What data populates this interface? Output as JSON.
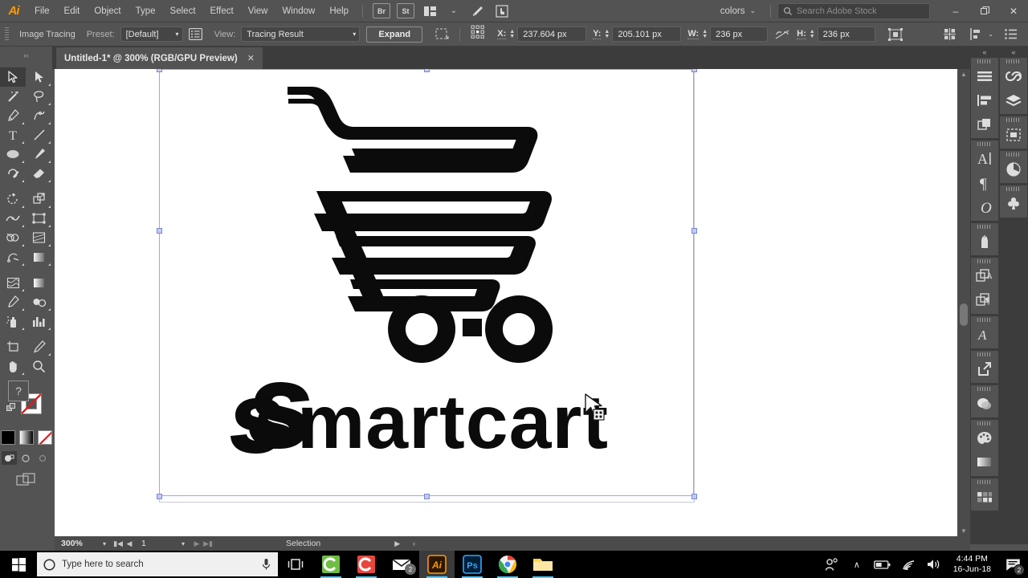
{
  "app": {
    "name": "Adobe Illustrator",
    "logo_text": "Ai",
    "accent_color": "#ff9a00",
    "chrome_color": "#535353",
    "selection_color": "#9aa7e8"
  },
  "menubar": {
    "items": [
      "File",
      "Edit",
      "Object",
      "Type",
      "Select",
      "Effect",
      "View",
      "Window",
      "Help"
    ],
    "bridge_label": "Br",
    "stock_label": "St",
    "arrange_icon": "arrange-documents-icon",
    "workspace_caret": "⌄",
    "brush_icon": "brush-icon",
    "touch_icon": "touch-workspace-icon",
    "workspace_name": "colors",
    "workspace_caret2": "⌄",
    "search_placeholder": "Search Adobe Stock",
    "search_value": "",
    "win_minimize": "–",
    "win_restore": "❐",
    "win_close": "✕"
  },
  "controlbar": {
    "title": "Image Tracing",
    "preset_label": "Preset:",
    "preset_value": "[Default]",
    "tracing_panel_icon": "image-tracing-panel-icon",
    "view_label": "View:",
    "view_value": "Tracing Result",
    "expand_label": "Expand",
    "transform_icon": "transform-selection-icon",
    "reference_point": "reference-point-grid",
    "x_label": "X:",
    "x_value": "237.604 px",
    "y_label": "Y:",
    "y_value": "205.101 px",
    "w_label": "W:",
    "w_value": "236 px",
    "lock_ratio_icon": "unlink-proportions-icon",
    "h_label": "H:",
    "h_value": "236 px",
    "shape_icon": "bounding-box-icon",
    "align_icon": "align-icon",
    "distribute_icon": "distribute-icon",
    "distribute_caret": "⌄",
    "options_icon": "more-options-icon"
  },
  "document": {
    "tab_title": "Untitled-1* @ 300% (RGB/GPU Preview)",
    "tab_close": "✕"
  },
  "toolbar": {
    "grip": "‹‹",
    "tools": [
      {
        "name": "selection-tool",
        "active": true
      },
      {
        "name": "direct-selection-tool",
        "active": false
      },
      {
        "name": "magic-wand-tool",
        "active": false
      },
      {
        "name": "lasso-tool",
        "active": false
      },
      {
        "name": "pen-tool",
        "active": false
      },
      {
        "name": "curvature-tool",
        "active": false
      },
      {
        "name": "type-tool",
        "active": false
      },
      {
        "name": "line-segment-tool",
        "active": false
      },
      {
        "name": "ellipse-tool",
        "active": false
      },
      {
        "name": "paintbrush-tool",
        "active": false
      },
      {
        "name": "shaper-tool",
        "active": false
      },
      {
        "name": "eraser-tool",
        "active": false
      },
      {
        "name": "rotate-tool",
        "active": false
      },
      {
        "name": "scale-tool",
        "active": false
      },
      {
        "name": "width-tool",
        "active": false
      },
      {
        "name": "free-transform-tool",
        "active": false
      },
      {
        "name": "shape-builder-tool",
        "active": false
      },
      {
        "name": "perspective-grid-tool",
        "active": false
      },
      {
        "name": "mesh-tool",
        "active": false
      },
      {
        "name": "gradient-tool",
        "active": false
      },
      {
        "name": "eyedropper-tool",
        "active": false
      },
      {
        "name": "blend-tool",
        "active": false
      },
      {
        "name": "symbol-sprayer-tool",
        "active": false
      },
      {
        "name": "column-graph-tool",
        "active": false
      },
      {
        "name": "artboard-tool",
        "active": false
      },
      {
        "name": "slice-tool",
        "active": false
      },
      {
        "name": "hand-tool",
        "active": false
      },
      {
        "name": "zoom-tool",
        "active": false
      }
    ],
    "fill_label": "?",
    "fill_color": "#535353",
    "stroke_color": "#ffffff",
    "swatch_black": "#000000",
    "swatch_gradient": "linear-gradient",
    "swatch_none": "none",
    "draw_modes": [
      "draw-normal",
      "draw-behind",
      "draw-inside"
    ],
    "screen_mode": "change-screen-mode"
  },
  "canvas": {
    "background": "#ffffff",
    "artwork_name": "smartcart-logo",
    "wordmark": "smartcart",
    "cart_icon": "shopping-cart-artwork",
    "cursor": "selection-arrow-cursor"
  },
  "statusbar": {
    "zoom_value": "300%",
    "zoom_caret": "⌄",
    "nav_first": "⏮",
    "nav_prev": "◀",
    "page_value": "1",
    "page_caret": "⌄",
    "nav_next": "▶",
    "nav_last": "⏭",
    "tool_status": "Selection",
    "arrow_right": "▶",
    "arrow_left": "‹"
  },
  "dock": {
    "collapse_left": "«",
    "collapse_right": "«",
    "groups_left": [
      [
        "align-panel-icon",
        "align-objects-icon",
        "pathfinder-panel-icon"
      ],
      [
        "character-panel-icon",
        "paragraph-panel-icon",
        "glyphs-panel-icon"
      ],
      [
        "brushes-panel-icon"
      ],
      [
        "appearance-panel-icon",
        "graphic-styles-panel-icon"
      ],
      [
        "type-styles-panel-icon"
      ],
      [
        "export-panel-icon"
      ],
      [
        "transparency-panel-icon"
      ],
      [
        "color-panel-icon",
        "color-guide-panel-icon"
      ],
      [
        "swatches-panel-icon"
      ]
    ],
    "groups_right": [
      [
        "libraries-panel-icon",
        "layers-panel-icon"
      ],
      [
        "artboards-panel-icon"
      ],
      [
        "image-trace-panel-icon"
      ],
      [
        "symbols-panel-icon"
      ]
    ]
  },
  "taskbar": {
    "start_icon": "windows-start-icon",
    "search_placeholder": "Type here to search",
    "cortana_icon": "microphone-icon",
    "task_view_icon": "task-view-icon",
    "apps": [
      {
        "name": "camtasia-app-icon",
        "label": "C",
        "color": "#6fbe44",
        "active": false,
        "running": true
      },
      {
        "name": "camtasia-recorder-app-icon",
        "label": "C",
        "color": "#e8453c",
        "active": false,
        "running": true
      },
      {
        "name": "mail-app-icon",
        "label": "✉",
        "color": "#ffffff",
        "active": false,
        "running": false,
        "badge": "2"
      },
      {
        "name": "illustrator-app-icon",
        "label": "Ai",
        "color": "#ff9a00",
        "active": true,
        "running": true
      },
      {
        "name": "photoshop-app-icon",
        "label": "Ps",
        "color": "#31a8ff",
        "active": false,
        "running": true
      },
      {
        "name": "chrome-app-icon",
        "label": "",
        "color": "#4285f4",
        "active": false,
        "running": true
      },
      {
        "name": "file-explorer-app-icon",
        "label": "",
        "color": "#ffd04b",
        "active": false,
        "running": true
      }
    ],
    "tray": {
      "people_icon": "people-icon",
      "show_hidden_icon": "∧",
      "battery_icon": "battery-icon",
      "network_icon": "wifi-icon",
      "volume_icon": "volume-icon",
      "time": "4:44 PM",
      "date": "16-Jun-18",
      "action_center_icon": "action-center-icon",
      "action_center_badge": "2"
    }
  }
}
